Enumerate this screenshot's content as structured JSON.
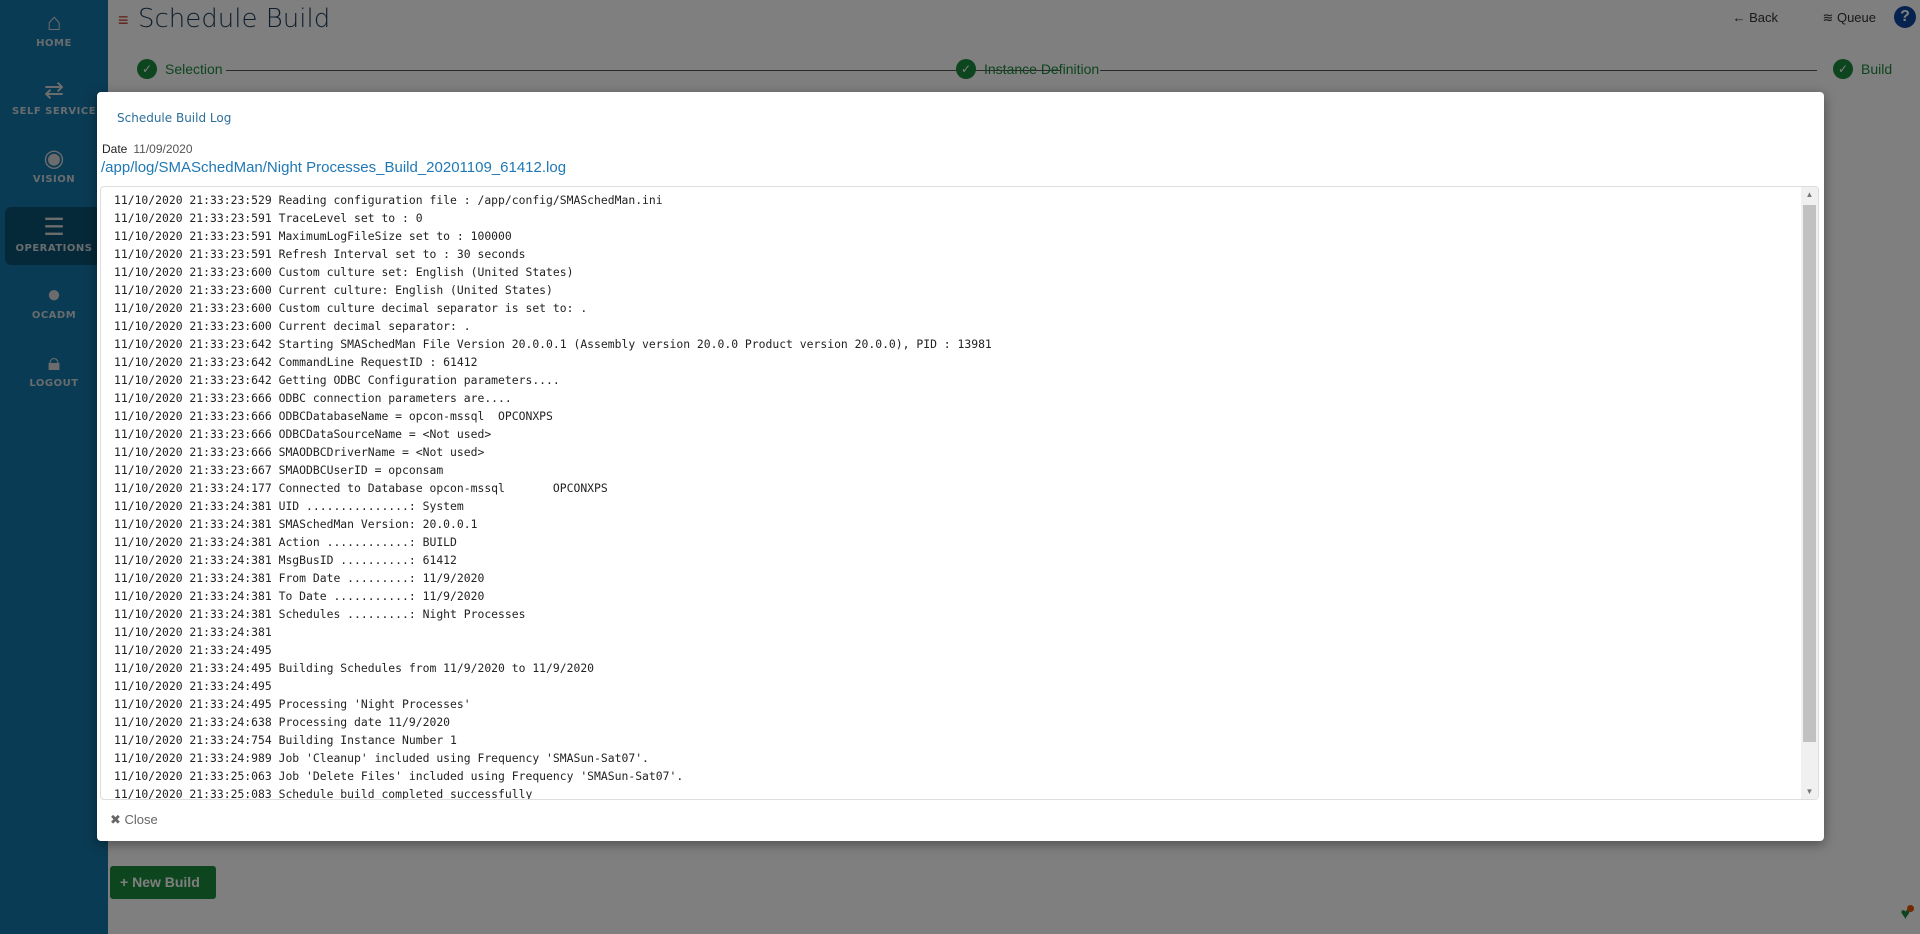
{
  "sidebar": {
    "items": [
      {
        "label": "HOME",
        "icon": "home-icon"
      },
      {
        "label": "SELF SERVICE",
        "icon": "arrows-icon"
      },
      {
        "label": "VISION",
        "icon": "eye-icon"
      },
      {
        "label": "OPERATIONS",
        "icon": "tasks-icon",
        "active": true
      },
      {
        "label": "OCADM",
        "icon": "user-icon"
      },
      {
        "label": "LOGOUT",
        "icon": "lock-icon"
      }
    ]
  },
  "header": {
    "title": "Schedule Build",
    "back": "Back",
    "queue": "Queue",
    "help": "?"
  },
  "steps": [
    "Selection",
    "Instance Definition",
    "Build"
  ],
  "new_build": "New Build",
  "modal": {
    "title": "Schedule Build Log",
    "date_label": "Date",
    "date_value": "11/09/2020",
    "path": "/app/log/SMASchedMan/Night Processes_Build_20201109_61412.log",
    "close": "Close",
    "log": [
      "11/10/2020 21:33:23:529 Reading configuration file : /app/config/SMASchedMan.ini",
      "11/10/2020 21:33:23:591 TraceLevel set to : 0",
      "11/10/2020 21:33:23:591 MaximumLogFileSize set to : 100000",
      "11/10/2020 21:33:23:591 Refresh Interval set to : 30 seconds",
      "11/10/2020 21:33:23:600 Custom culture set: English (United States)",
      "11/10/2020 21:33:23:600 Current culture: English (United States)",
      "11/10/2020 21:33:23:600 Custom culture decimal separator is set to: .",
      "11/10/2020 21:33:23:600 Current decimal separator: .",
      "11/10/2020 21:33:23:642 Starting SMASchedMan File Version 20.0.0.1 (Assembly version 20.0.0 Product version 20.0.0), PID : 13981",
      "11/10/2020 21:33:23:642 CommandLine RequestID : 61412",
      "11/10/2020 21:33:23:642 Getting ODBC Configuration parameters....",
      "11/10/2020 21:33:23:666 ODBC connection parameters are....",
      "11/10/2020 21:33:23:666 ODBCDatabaseName = opcon-mssql  OPCONXPS",
      "11/10/2020 21:33:23:666 ODBCDataSourceName = <Not used>",
      "11/10/2020 21:33:23:666 SMAODBCDriverName = <Not used>",
      "11/10/2020 21:33:23:667 SMAODBCUserID = opconsam",
      "11/10/2020 21:33:24:177 Connected to Database opcon-mssql       OPCONXPS",
      "11/10/2020 21:33:24:381 UID ...............: System",
      "11/10/2020 21:33:24:381 SMASchedMan Version: 20.0.0.1",
      "11/10/2020 21:33:24:381 Action ............: BUILD",
      "11/10/2020 21:33:24:381 MsgBusID ..........: 61412",
      "11/10/2020 21:33:24:381 From Date .........: 11/9/2020",
      "11/10/2020 21:33:24:381 To Date ...........: 11/9/2020",
      "11/10/2020 21:33:24:381 Schedules .........: Night Processes",
      "11/10/2020 21:33:24:381",
      "11/10/2020 21:33:24:495",
      "11/10/2020 21:33:24:495 Building Schedules from 11/9/2020 to 11/9/2020",
      "11/10/2020 21:33:24:495",
      "11/10/2020 21:33:24:495 Processing 'Night Processes'",
      "11/10/2020 21:33:24:638 Processing date 11/9/2020",
      "11/10/2020 21:33:24:754 Building Instance Number 1",
      "11/10/2020 21:33:24:989 Job 'Cleanup' included using Frequency 'SMASun-Sat07'.",
      "11/10/2020 21:33:25:063 Job 'Delete Files' included using Frequency 'SMASun-Sat07'.",
      "11/10/2020 21:33:25:083 Schedule build completed successfully"
    ]
  }
}
